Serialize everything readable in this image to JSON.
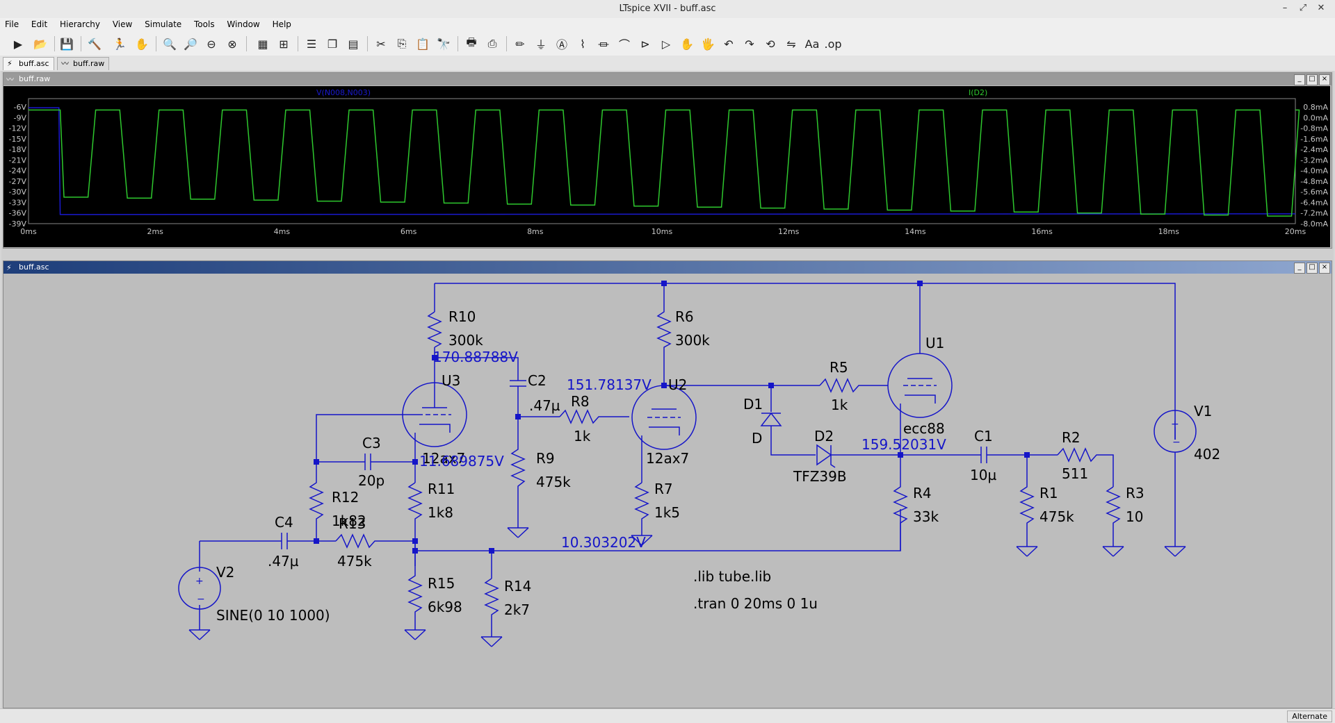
{
  "window": {
    "title": "LTspice XVII - buff.asc"
  },
  "menu": [
    "File",
    "Edit",
    "Hierarchy",
    "View",
    "Simulate",
    "Tools",
    "Window",
    "Help"
  ],
  "tabs": [
    {
      "label": "buff.asc",
      "icon": "schematic-icon"
    },
    {
      "label": "buff.raw",
      "icon": "waveform-icon"
    }
  ],
  "waveform_window": {
    "title": "buff.raw",
    "trace_labels": [
      "V(N008,N003)",
      "I(D2)"
    ],
    "colors": {
      "voltage": "#1a1ad0",
      "current": "#2ec82e",
      "grid": "#000000"
    }
  },
  "schematic_window": {
    "title": "buff.asc"
  },
  "chart_data": {
    "type": "line",
    "x_ticks": [
      "0ms",
      "2ms",
      "4ms",
      "6ms",
      "8ms",
      "10ms",
      "12ms",
      "14ms",
      "16ms",
      "18ms",
      "20ms"
    ],
    "left_ticks": [
      "-6V",
      "-9V",
      "-12V",
      "-15V",
      "-18V",
      "-21V",
      "-24V",
      "-27V",
      "-30V",
      "-33V",
      "-36V",
      "-39V"
    ],
    "right_ticks": [
      "0.8mA",
      "0.0mA",
      "-0.8mA",
      "-1.6mA",
      "-2.4mA",
      "-3.2mA",
      "-4.0mA",
      "-4.8mA",
      "-5.6mA",
      "-6.4mA",
      "-7.2mA",
      "-8.0mA"
    ],
    "xlim": [
      0,
      20
    ],
    "ylim_left": [
      -39,
      -6
    ],
    "ylim_right": [
      -8.0,
      0.8
    ],
    "series": [
      {
        "name": "V(N008,N003)",
        "axis": "left",
        "x": [
          0,
          0.48,
          0.5,
          20
        ],
        "y": [
          -8.4,
          -8.4,
          -36.6,
          -36.4
        ]
      },
      {
        "name": "I(D2)",
        "axis": "right",
        "high_mA": 0.0,
        "low_start_mA": -6.1,
        "low_end_mA": -7.5,
        "period_ms": 1.0,
        "start_ms": 0.5
      }
    ]
  },
  "schematic": {
    "components": [
      {
        "ref": "R10",
        "value": "300k"
      },
      {
        "ref": "R6",
        "value": "300k"
      },
      {
        "ref": "U1",
        "value": "ecc88"
      },
      {
        "ref": "U3",
        "value": "12ax7"
      },
      {
        "ref": "C2",
        "value": ".47µ"
      },
      {
        "ref": "R8",
        "value": "1k"
      },
      {
        "ref": "U2",
        "value": "12ax7"
      },
      {
        "ref": "R5",
        "value": "1k"
      },
      {
        "ref": "D1",
        "value": "D"
      },
      {
        "ref": "D2",
        "value": "TFZ39B"
      },
      {
        "ref": "C1",
        "value": "10µ"
      },
      {
        "ref": "R2",
        "value": "511"
      },
      {
        "ref": "V1",
        "value": "402"
      },
      {
        "ref": "C3",
        "value": "20p"
      },
      {
        "ref": "R9",
        "value": "475k"
      },
      {
        "ref": "R11",
        "value": "1k8"
      },
      {
        "ref": "R12",
        "value": "1k82"
      },
      {
        "ref": "R7",
        "value": "1k5"
      },
      {
        "ref": "R4",
        "value": "33k"
      },
      {
        "ref": "R1",
        "value": "475k"
      },
      {
        "ref": "R3",
        "value": "10"
      },
      {
        "ref": "C4",
        "value": ".47µ"
      },
      {
        "ref": "R13",
        "value": "475k"
      },
      {
        "ref": "V2",
        "value": "SINE(0 10 1000)"
      },
      {
        "ref": "R15",
        "value": "6k98"
      },
      {
        "ref": "R14",
        "value": "2k7"
      }
    ],
    "node_voltages": [
      "170.88788V",
      "151.78137V",
      "159.52031V",
      "11.689875V",
      "10.303202V"
    ],
    "directives": [
      ".lib tube.lib",
      ".tran 0 20ms 0 1u"
    ]
  },
  "status": {
    "mode": "Alternate"
  }
}
